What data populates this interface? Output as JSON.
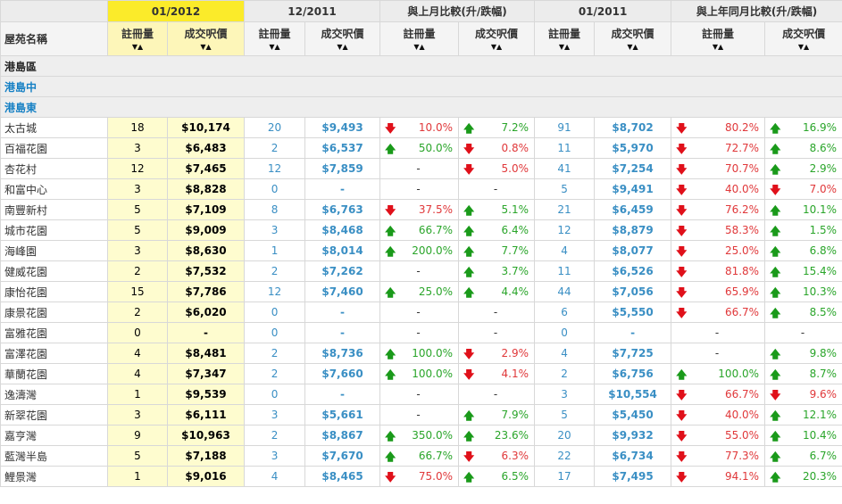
{
  "periods": {
    "current": "01/2012",
    "prev_month": "12/2011",
    "mom": "與上月比較(升/跌幅)",
    "prev_year": "01/2011",
    "yoy": "與上年同月比較(升/跌幅)"
  },
  "headers": {
    "estate": "屋苑名稱",
    "registrations": "註冊量",
    "avg_price": "成交呎價",
    "sort_glyph": "▼▲"
  },
  "region": "港島區",
  "districts": [
    "港島中",
    "港島東"
  ],
  "rows": [
    {
      "name": "太古城",
      "cur_reg": "18",
      "cur_price": "$10,174",
      "pm_reg": "20",
      "pm_price": "$9,493",
      "mom_reg": {
        "dir": "down",
        "val": "10.0%"
      },
      "mom_price": {
        "dir": "up",
        "val": "7.2%"
      },
      "py_reg": "91",
      "py_price": "$8,702",
      "yoy_reg": {
        "dir": "down",
        "val": "80.2%"
      },
      "yoy_price": {
        "dir": "up",
        "val": "16.9%"
      }
    },
    {
      "name": "百福花園",
      "cur_reg": "3",
      "cur_price": "$6,483",
      "pm_reg": "2",
      "pm_price": "$6,537",
      "mom_reg": {
        "dir": "up",
        "val": "50.0%"
      },
      "mom_price": {
        "dir": "down",
        "val": "0.8%"
      },
      "py_reg": "11",
      "py_price": "$5,970",
      "yoy_reg": {
        "dir": "down",
        "val": "72.7%"
      },
      "yoy_price": {
        "dir": "up",
        "val": "8.6%"
      }
    },
    {
      "name": "杏花村",
      "cur_reg": "12",
      "cur_price": "$7,465",
      "pm_reg": "12",
      "pm_price": "$7,859",
      "mom_reg": {
        "dir": "none",
        "val": "-"
      },
      "mom_price": {
        "dir": "down",
        "val": "5.0%"
      },
      "py_reg": "41",
      "py_price": "$7,254",
      "yoy_reg": {
        "dir": "down",
        "val": "70.7%"
      },
      "yoy_price": {
        "dir": "up",
        "val": "2.9%"
      }
    },
    {
      "name": "和富中心",
      "cur_reg": "3",
      "cur_price": "$8,828",
      "pm_reg": "0",
      "pm_price": "-",
      "mom_reg": {
        "dir": "none",
        "val": "-"
      },
      "mom_price": {
        "dir": "none",
        "val": "-"
      },
      "py_reg": "5",
      "py_price": "$9,491",
      "yoy_reg": {
        "dir": "down",
        "val": "40.0%"
      },
      "yoy_price": {
        "dir": "down",
        "val": "7.0%"
      }
    },
    {
      "name": "南豐新村",
      "cur_reg": "5",
      "cur_price": "$7,109",
      "pm_reg": "8",
      "pm_price": "$6,763",
      "mom_reg": {
        "dir": "down",
        "val": "37.5%"
      },
      "mom_price": {
        "dir": "up",
        "val": "5.1%"
      },
      "py_reg": "21",
      "py_price": "$6,459",
      "yoy_reg": {
        "dir": "down",
        "val": "76.2%"
      },
      "yoy_price": {
        "dir": "up",
        "val": "10.1%"
      }
    },
    {
      "name": "城市花園",
      "cur_reg": "5",
      "cur_price": "$9,009",
      "pm_reg": "3",
      "pm_price": "$8,468",
      "mom_reg": {
        "dir": "up",
        "val": "66.7%"
      },
      "mom_price": {
        "dir": "up",
        "val": "6.4%"
      },
      "py_reg": "12",
      "py_price": "$8,879",
      "yoy_reg": {
        "dir": "down",
        "val": "58.3%"
      },
      "yoy_price": {
        "dir": "up",
        "val": "1.5%"
      }
    },
    {
      "name": "海峰園",
      "cur_reg": "3",
      "cur_price": "$8,630",
      "pm_reg": "1",
      "pm_price": "$8,014",
      "mom_reg": {
        "dir": "up",
        "val": "200.0%"
      },
      "mom_price": {
        "dir": "up",
        "val": "7.7%"
      },
      "py_reg": "4",
      "py_price": "$8,077",
      "yoy_reg": {
        "dir": "down",
        "val": "25.0%"
      },
      "yoy_price": {
        "dir": "up",
        "val": "6.8%"
      }
    },
    {
      "name": "健威花園",
      "cur_reg": "2",
      "cur_price": "$7,532",
      "pm_reg": "2",
      "pm_price": "$7,262",
      "mom_reg": {
        "dir": "none",
        "val": "-"
      },
      "mom_price": {
        "dir": "up",
        "val": "3.7%"
      },
      "py_reg": "11",
      "py_price": "$6,526",
      "yoy_reg": {
        "dir": "down",
        "val": "81.8%"
      },
      "yoy_price": {
        "dir": "up",
        "val": "15.4%"
      }
    },
    {
      "name": "康怡花園",
      "cur_reg": "15",
      "cur_price": "$7,786",
      "pm_reg": "12",
      "pm_price": "$7,460",
      "mom_reg": {
        "dir": "up",
        "val": "25.0%"
      },
      "mom_price": {
        "dir": "up",
        "val": "4.4%"
      },
      "py_reg": "44",
      "py_price": "$7,056",
      "yoy_reg": {
        "dir": "down",
        "val": "65.9%"
      },
      "yoy_price": {
        "dir": "up",
        "val": "10.3%"
      }
    },
    {
      "name": "康景花園",
      "cur_reg": "2",
      "cur_price": "$6,020",
      "pm_reg": "0",
      "pm_price": "-",
      "mom_reg": {
        "dir": "none",
        "val": "-"
      },
      "mom_price": {
        "dir": "none",
        "val": "-"
      },
      "py_reg": "6",
      "py_price": "$5,550",
      "yoy_reg": {
        "dir": "down",
        "val": "66.7%"
      },
      "yoy_price": {
        "dir": "up",
        "val": "8.5%"
      }
    },
    {
      "name": "富雅花園",
      "cur_reg": "0",
      "cur_price": "-",
      "pm_reg": "0",
      "pm_price": "-",
      "mom_reg": {
        "dir": "none",
        "val": "-"
      },
      "mom_price": {
        "dir": "none",
        "val": "-"
      },
      "py_reg": "0",
      "py_price": "-",
      "yoy_reg": {
        "dir": "none",
        "val": "-"
      },
      "yoy_price": {
        "dir": "none",
        "val": "-"
      }
    },
    {
      "name": "富澤花園",
      "cur_reg": "4",
      "cur_price": "$8,481",
      "pm_reg": "2",
      "pm_price": "$8,736",
      "mom_reg": {
        "dir": "up",
        "val": "100.0%"
      },
      "mom_price": {
        "dir": "down",
        "val": "2.9%"
      },
      "py_reg": "4",
      "py_price": "$7,725",
      "yoy_reg": {
        "dir": "none",
        "val": "-"
      },
      "yoy_price": {
        "dir": "up",
        "val": "9.8%"
      }
    },
    {
      "name": "華蘭花園",
      "cur_reg": "4",
      "cur_price": "$7,347",
      "pm_reg": "2",
      "pm_price": "$7,660",
      "mom_reg": {
        "dir": "up",
        "val": "100.0%"
      },
      "mom_price": {
        "dir": "down",
        "val": "4.1%"
      },
      "py_reg": "2",
      "py_price": "$6,756",
      "yoy_reg": {
        "dir": "up",
        "val": "100.0%"
      },
      "yoy_price": {
        "dir": "up",
        "val": "8.7%"
      }
    },
    {
      "name": "逸濤灣",
      "cur_reg": "1",
      "cur_price": "$9,539",
      "pm_reg": "0",
      "pm_price": "-",
      "mom_reg": {
        "dir": "none",
        "val": "-"
      },
      "mom_price": {
        "dir": "none",
        "val": "-"
      },
      "py_reg": "3",
      "py_price": "$10,554",
      "yoy_reg": {
        "dir": "down",
        "val": "66.7%"
      },
      "yoy_price": {
        "dir": "down",
        "val": "9.6%"
      }
    },
    {
      "name": "新翠花園",
      "cur_reg": "3",
      "cur_price": "$6,111",
      "pm_reg": "3",
      "pm_price": "$5,661",
      "mom_reg": {
        "dir": "none",
        "val": "-"
      },
      "mom_price": {
        "dir": "up",
        "val": "7.9%"
      },
      "py_reg": "5",
      "py_price": "$5,450",
      "yoy_reg": {
        "dir": "down",
        "val": "40.0%"
      },
      "yoy_price": {
        "dir": "up",
        "val": "12.1%"
      }
    },
    {
      "name": "嘉亨灣",
      "cur_reg": "9",
      "cur_price": "$10,963",
      "pm_reg": "2",
      "pm_price": "$8,867",
      "mom_reg": {
        "dir": "up",
        "val": "350.0%"
      },
      "mom_price": {
        "dir": "up",
        "val": "23.6%"
      },
      "py_reg": "20",
      "py_price": "$9,932",
      "yoy_reg": {
        "dir": "down",
        "val": "55.0%"
      },
      "yoy_price": {
        "dir": "up",
        "val": "10.4%"
      }
    },
    {
      "name": "藍灣半島",
      "cur_reg": "5",
      "cur_price": "$7,188",
      "pm_reg": "3",
      "pm_price": "$7,670",
      "mom_reg": {
        "dir": "up",
        "val": "66.7%"
      },
      "mom_price": {
        "dir": "down",
        "val": "6.3%"
      },
      "py_reg": "22",
      "py_price": "$6,734",
      "yoy_reg": {
        "dir": "down",
        "val": "77.3%"
      },
      "yoy_price": {
        "dir": "up",
        "val": "6.7%"
      }
    },
    {
      "name": "鯉景灣",
      "cur_reg": "1",
      "cur_price": "$9,016",
      "pm_reg": "4",
      "pm_price": "$8,465",
      "mom_reg": {
        "dir": "down",
        "val": "75.0%"
      },
      "mom_price": {
        "dir": "up",
        "val": "6.5%"
      },
      "py_reg": "17",
      "py_price": "$7,495",
      "yoy_reg": {
        "dir": "down",
        "val": "94.1%"
      },
      "yoy_price": {
        "dir": "up",
        "val": "20.3%"
      }
    }
  ]
}
